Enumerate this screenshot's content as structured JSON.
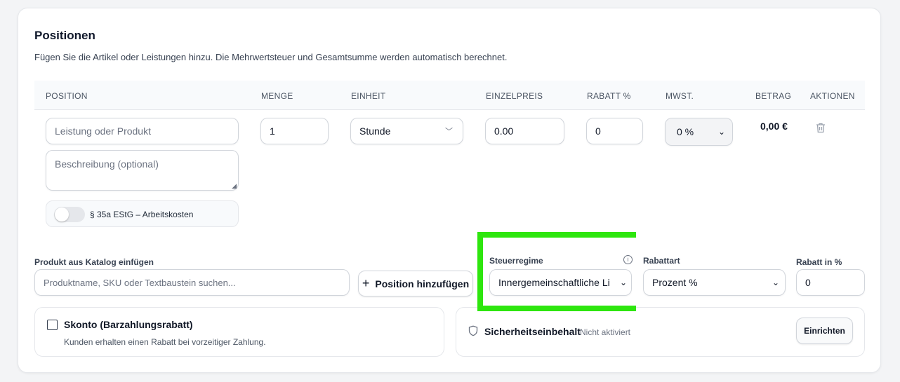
{
  "section": {
    "title": "Positionen",
    "subtitle": "Fügen Sie die Artikel oder Leistungen hinzu. Die Mehrwertsteuer und Gesamtsumme werden automatisch berechnet."
  },
  "table": {
    "headers": {
      "position": "Position",
      "menge": "Menge",
      "einheit": "Einheit",
      "einzelpreis": "Einzelpreis",
      "rabatt": "Rabatt %",
      "mwst": "MwSt.",
      "betrag": "Betrag",
      "aktionen": "Aktionen"
    },
    "row": {
      "position_placeholder": "Leistung oder Produkt",
      "beschreibung_placeholder": "Beschreibung (optional)",
      "menge": "1",
      "einheit": "Stunde",
      "einzelpreis": "0.00",
      "rabatt": "0",
      "mwst": "0 %",
      "betrag": "0,00 €",
      "toggle_label": "§ 35a EStG – Arbeitskosten",
      "toggle_on": false
    }
  },
  "catalog": {
    "label": "Produkt aus Katalog einfügen",
    "placeholder": "Produktname, SKU oder Textbaustein suchen..."
  },
  "add_position_button": {
    "icon": "+",
    "label": "Position hinzufügen"
  },
  "steuerregime": {
    "label": "Steuerregime",
    "value": "Innergemeinschaftliche Li",
    "info_icon": "i"
  },
  "rabattart": {
    "label": "Rabattart",
    "value": "Prozent %"
  },
  "rabatt_prozent": {
    "label": "Rabatt in %",
    "value": "0"
  },
  "skonto": {
    "label": "Skonto (Barzahlungsrabatt)",
    "description": "Kunden erhalten einen Rabatt bei vorzeitiger Zahlung.",
    "checked": false
  },
  "sicherheitseinbehalt": {
    "label": "Sicherheitseinbehalt",
    "status": "Nicht aktiviert",
    "button": "Einrichten"
  },
  "colors": {
    "highlight": "#2ee60e",
    "accent_text": "#111827"
  }
}
